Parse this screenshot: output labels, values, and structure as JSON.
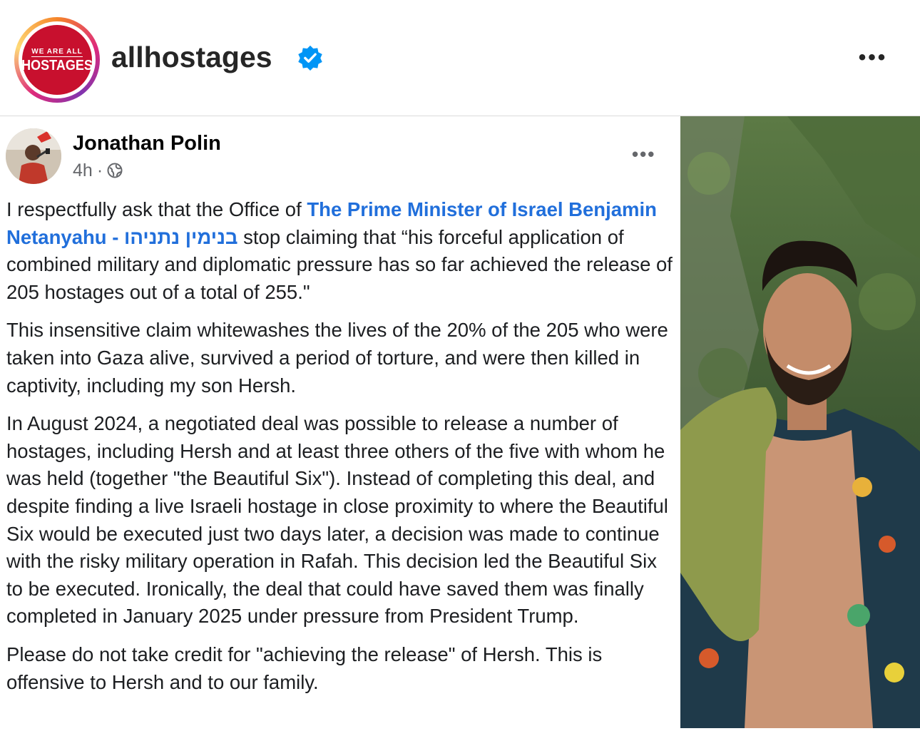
{
  "header": {
    "avatar_logo_top": "WE ARE ALL",
    "avatar_logo_main": "HOSTAGES",
    "username": "allhostages",
    "verified_icon": "verified-badge-icon",
    "more_icon": "more-options-icon",
    "more_label": "•••"
  },
  "post": {
    "author": "Jonathan Polin",
    "time": "4h",
    "separator": "·",
    "privacy_icon": "globe-icon",
    "more_label": "•••",
    "paragraphs": {
      "p1_pre": "I respectfully ask that the Office of ",
      "p1_mention": "The Prime Minister of Israel Benjamin Netanyahu - בנימין נתניהו",
      "p1_post": " stop claiming that “his forceful application of combined military and diplomatic pressure has so far achieved the release of 205 hostages out of a total of 255.\"",
      "p2": "This insensitive claim whitewashes the lives of the 20% of the 205 who were taken into Gaza alive, survived a period of torture, and were then killed in captivity, including my son Hersh.",
      "p3": "In August 2024, a negotiated deal was possible to release a number of hostages, including Hersh and at least three others of the five with whom he was held (together \"the Beautiful Six\"). Instead of completing this deal, and despite finding a live Israeli hostage in close proximity to where the Beautiful Six would be executed just two days later, a decision was made to continue with the risky military operation in Rafah. This decision led the Beautiful Six to be executed. Ironically, the deal that could have saved them was finally completed in January 2025 under pressure from President Trump.",
      "p4": "Please do not take credit for \"achieving the release\" of Hersh. This is offensive to Hersh and to our family."
    }
  },
  "colors": {
    "mention": "#216fdb",
    "verified": "#0095f6",
    "logo_red": "#c8102e"
  }
}
